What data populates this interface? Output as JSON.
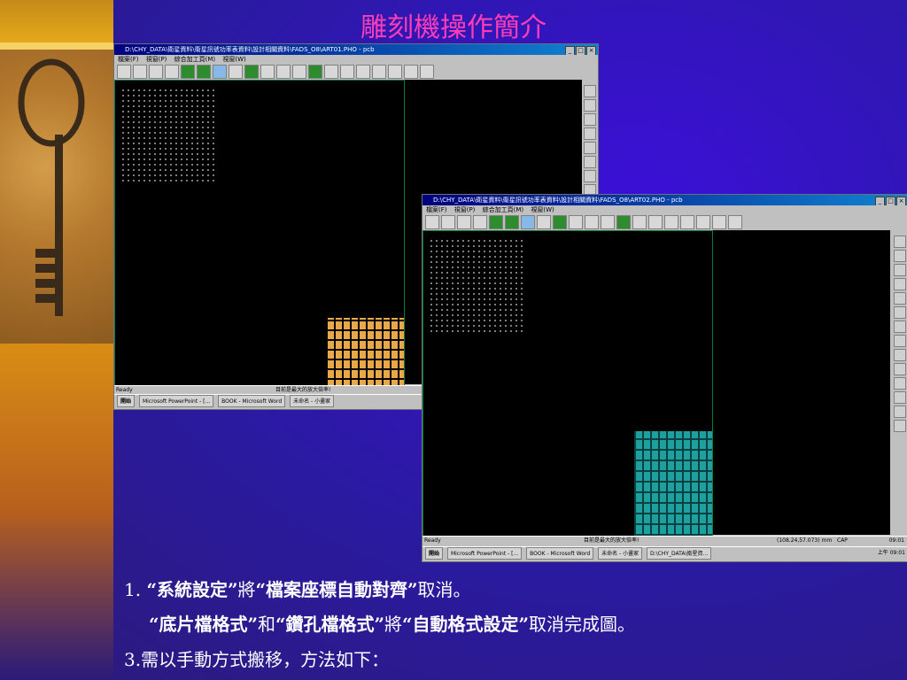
{
  "slide": {
    "title": "雕刻機操作簡介",
    "line1": {
      "num": "1. ",
      "q1": "“系統設定”",
      "mid": "將",
      "q2": "“檔案座標自動對齊”",
      "end": "取消。"
    },
    "line2": {
      "q1": "“底片檔格式”",
      "mid1": "和",
      "q2": "“鑽孔檔格式”",
      "mid2": "將",
      "q3": "“自動格式設定”",
      "end": "取消完成圖。"
    },
    "line3": "3.需以手動方式搬移，方法如下："
  },
  "window1": {
    "title": "D:\\CHY_DATA\\衛星資料\\衛星訊號功率表資料\\設計相關資料\\FADS_O8\\ART01.PHO - pcb",
    "menu": [
      "檔案(F)",
      "視窗(P)",
      "綜合加工頁(M)",
      "視窗(W)"
    ],
    "status_left": "Ready",
    "status_mid": "目前是最大的放大倍率!",
    "taskbar": {
      "start": "開始",
      "items": [
        "Microsoft PowerPoint - [...",
        "BOOK - Microsoft Word",
        "未命名 - 小畫家"
      ]
    }
  },
  "window2": {
    "title": "D:\\CHY_DATA\\衛星資料\\衛星訊號功率表資料\\設計相關資料\\FADS_O8\\ART02.PHO - pcb",
    "menu": [
      "檔案(F)",
      "視窗(P)",
      "綜合加工頁(M)",
      "視窗(W)"
    ],
    "status_left": "Ready",
    "status_mid": "目前是最大的放大倍率!",
    "status_coord": "(108.24,57.073) mm",
    "status_cap": "CAP",
    "status_time": "09:01",
    "taskbar": {
      "start": "開始",
      "items": [
        "Microsoft PowerPoint - [...",
        "BOOK - Microsoft Word",
        "未命名 - 小畫家",
        "D:\\CHY_DATA\\衛星資..."
      ],
      "clock": "上午 09:01"
    }
  },
  "colors": {
    "title": "#ff3db6",
    "pcb1": "#e8a848",
    "pcb2": "#1ea0a0"
  }
}
